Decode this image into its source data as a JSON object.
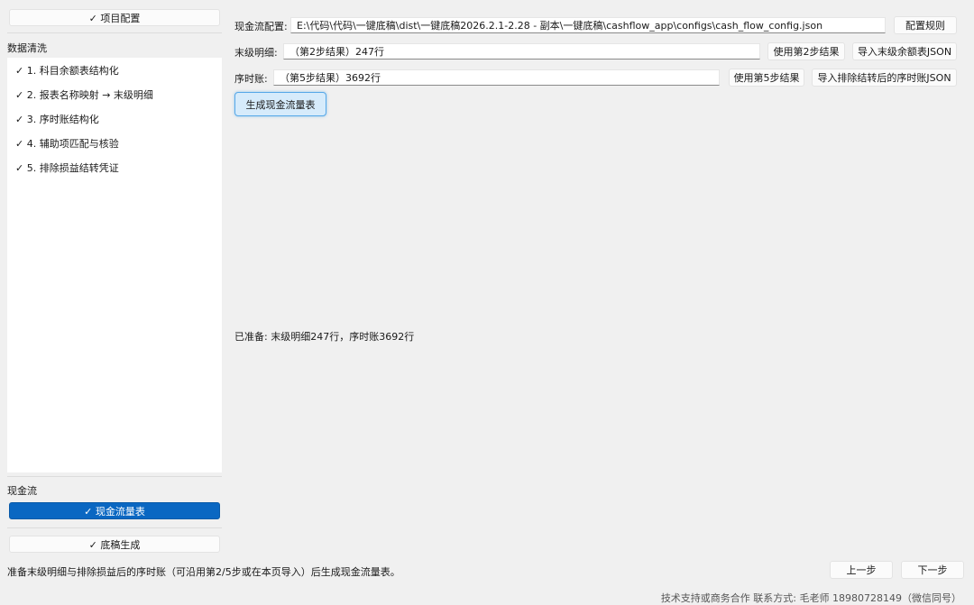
{
  "sidebar": {
    "project_config": "✓ 项目配置",
    "section_cleaning": "数据清洗",
    "steps": [
      "✓ 1. 科目余额表结构化",
      "✓ 2. 报表名称映射 → 末级明细",
      "✓ 3. 序时账结构化",
      "✓ 4. 辅助项匹配与核验",
      "✓ 5. 排除损益结转凭证"
    ],
    "section_cashflow": "现金流",
    "cashflow_item": "✓ 现金流量表",
    "draft_item": "✓ 底稿生成"
  },
  "main": {
    "config_label": "现金流配置:",
    "config_path": "E:\\代码\\代码\\一键底稿\\dist\\一键底稿2026.2.1-2.28 - 副本\\一键底稿\\cashflow_app\\configs\\cash_flow_config.json",
    "config_rules_button": "配置规则",
    "detail_label": "末级明细:",
    "detail_value": "（第2步结果）247行",
    "use_step2_button": "使用第2步结果",
    "import_balance_button": "导入末级余额表JSON",
    "journal_label": "序时账:",
    "journal_value": "（第5步结果）3692行",
    "use_step5_button": "使用第5步结果",
    "import_journal_button": "导入排除结转后的序时账JSON",
    "generate_button": "生成现金流量表",
    "status": "已准备: 末级明细247行，序时账3692行"
  },
  "bottom": {
    "hint": "准备末级明细与排除损益后的序时账（可沿用第2/5步或在本页导入）后生成现金流量表。",
    "prev_button": "上一步",
    "next_button": "下一步",
    "footer": "技术支持或商务合作 联系方式:   毛老师 18980728149（微信同号）"
  }
}
